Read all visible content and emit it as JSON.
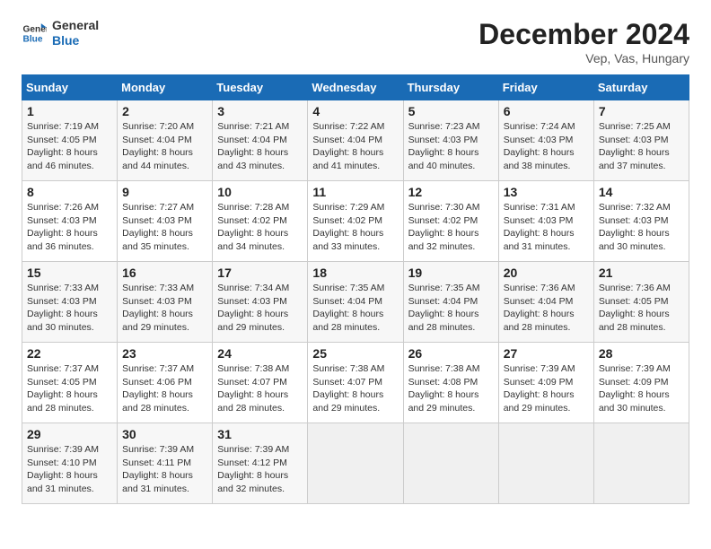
{
  "logo": {
    "line1": "General",
    "line2": "Blue"
  },
  "title": "December 2024",
  "subtitle": "Vep, Vas, Hungary",
  "days_of_week": [
    "Sunday",
    "Monday",
    "Tuesday",
    "Wednesday",
    "Thursday",
    "Friday",
    "Saturday"
  ],
  "weeks": [
    [
      {
        "day": "1",
        "sunrise": "Sunrise: 7:19 AM",
        "sunset": "Sunset: 4:05 PM",
        "daylight": "Daylight: 8 hours and 46 minutes."
      },
      {
        "day": "2",
        "sunrise": "Sunrise: 7:20 AM",
        "sunset": "Sunset: 4:04 PM",
        "daylight": "Daylight: 8 hours and 44 minutes."
      },
      {
        "day": "3",
        "sunrise": "Sunrise: 7:21 AM",
        "sunset": "Sunset: 4:04 PM",
        "daylight": "Daylight: 8 hours and 43 minutes."
      },
      {
        "day": "4",
        "sunrise": "Sunrise: 7:22 AM",
        "sunset": "Sunset: 4:04 PM",
        "daylight": "Daylight: 8 hours and 41 minutes."
      },
      {
        "day": "5",
        "sunrise": "Sunrise: 7:23 AM",
        "sunset": "Sunset: 4:03 PM",
        "daylight": "Daylight: 8 hours and 40 minutes."
      },
      {
        "day": "6",
        "sunrise": "Sunrise: 7:24 AM",
        "sunset": "Sunset: 4:03 PM",
        "daylight": "Daylight: 8 hours and 38 minutes."
      },
      {
        "day": "7",
        "sunrise": "Sunrise: 7:25 AM",
        "sunset": "Sunset: 4:03 PM",
        "daylight": "Daylight: 8 hours and 37 minutes."
      }
    ],
    [
      {
        "day": "8",
        "sunrise": "Sunrise: 7:26 AM",
        "sunset": "Sunset: 4:03 PM",
        "daylight": "Daylight: 8 hours and 36 minutes."
      },
      {
        "day": "9",
        "sunrise": "Sunrise: 7:27 AM",
        "sunset": "Sunset: 4:03 PM",
        "daylight": "Daylight: 8 hours and 35 minutes."
      },
      {
        "day": "10",
        "sunrise": "Sunrise: 7:28 AM",
        "sunset": "Sunset: 4:02 PM",
        "daylight": "Daylight: 8 hours and 34 minutes."
      },
      {
        "day": "11",
        "sunrise": "Sunrise: 7:29 AM",
        "sunset": "Sunset: 4:02 PM",
        "daylight": "Daylight: 8 hours and 33 minutes."
      },
      {
        "day": "12",
        "sunrise": "Sunrise: 7:30 AM",
        "sunset": "Sunset: 4:02 PM",
        "daylight": "Daylight: 8 hours and 32 minutes."
      },
      {
        "day": "13",
        "sunrise": "Sunrise: 7:31 AM",
        "sunset": "Sunset: 4:03 PM",
        "daylight": "Daylight: 8 hours and 31 minutes."
      },
      {
        "day": "14",
        "sunrise": "Sunrise: 7:32 AM",
        "sunset": "Sunset: 4:03 PM",
        "daylight": "Daylight: 8 hours and 30 minutes."
      }
    ],
    [
      {
        "day": "15",
        "sunrise": "Sunrise: 7:33 AM",
        "sunset": "Sunset: 4:03 PM",
        "daylight": "Daylight: 8 hours and 30 minutes."
      },
      {
        "day": "16",
        "sunrise": "Sunrise: 7:33 AM",
        "sunset": "Sunset: 4:03 PM",
        "daylight": "Daylight: 8 hours and 29 minutes."
      },
      {
        "day": "17",
        "sunrise": "Sunrise: 7:34 AM",
        "sunset": "Sunset: 4:03 PM",
        "daylight": "Daylight: 8 hours and 29 minutes."
      },
      {
        "day": "18",
        "sunrise": "Sunrise: 7:35 AM",
        "sunset": "Sunset: 4:04 PM",
        "daylight": "Daylight: 8 hours and 28 minutes."
      },
      {
        "day": "19",
        "sunrise": "Sunrise: 7:35 AM",
        "sunset": "Sunset: 4:04 PM",
        "daylight": "Daylight: 8 hours and 28 minutes."
      },
      {
        "day": "20",
        "sunrise": "Sunrise: 7:36 AM",
        "sunset": "Sunset: 4:04 PM",
        "daylight": "Daylight: 8 hours and 28 minutes."
      },
      {
        "day": "21",
        "sunrise": "Sunrise: 7:36 AM",
        "sunset": "Sunset: 4:05 PM",
        "daylight": "Daylight: 8 hours and 28 minutes."
      }
    ],
    [
      {
        "day": "22",
        "sunrise": "Sunrise: 7:37 AM",
        "sunset": "Sunset: 4:05 PM",
        "daylight": "Daylight: 8 hours and 28 minutes."
      },
      {
        "day": "23",
        "sunrise": "Sunrise: 7:37 AM",
        "sunset": "Sunset: 4:06 PM",
        "daylight": "Daylight: 8 hours and 28 minutes."
      },
      {
        "day": "24",
        "sunrise": "Sunrise: 7:38 AM",
        "sunset": "Sunset: 4:07 PM",
        "daylight": "Daylight: 8 hours and 28 minutes."
      },
      {
        "day": "25",
        "sunrise": "Sunrise: 7:38 AM",
        "sunset": "Sunset: 4:07 PM",
        "daylight": "Daylight: 8 hours and 29 minutes."
      },
      {
        "day": "26",
        "sunrise": "Sunrise: 7:38 AM",
        "sunset": "Sunset: 4:08 PM",
        "daylight": "Daylight: 8 hours and 29 minutes."
      },
      {
        "day": "27",
        "sunrise": "Sunrise: 7:39 AM",
        "sunset": "Sunset: 4:09 PM",
        "daylight": "Daylight: 8 hours and 29 minutes."
      },
      {
        "day": "28",
        "sunrise": "Sunrise: 7:39 AM",
        "sunset": "Sunset: 4:09 PM",
        "daylight": "Daylight: 8 hours and 30 minutes."
      }
    ],
    [
      {
        "day": "29",
        "sunrise": "Sunrise: 7:39 AM",
        "sunset": "Sunset: 4:10 PM",
        "daylight": "Daylight: 8 hours and 31 minutes."
      },
      {
        "day": "30",
        "sunrise": "Sunrise: 7:39 AM",
        "sunset": "Sunset: 4:11 PM",
        "daylight": "Daylight: 8 hours and 31 minutes."
      },
      {
        "day": "31",
        "sunrise": "Sunrise: 7:39 AM",
        "sunset": "Sunset: 4:12 PM",
        "daylight": "Daylight: 8 hours and 32 minutes."
      },
      null,
      null,
      null,
      null
    ]
  ]
}
